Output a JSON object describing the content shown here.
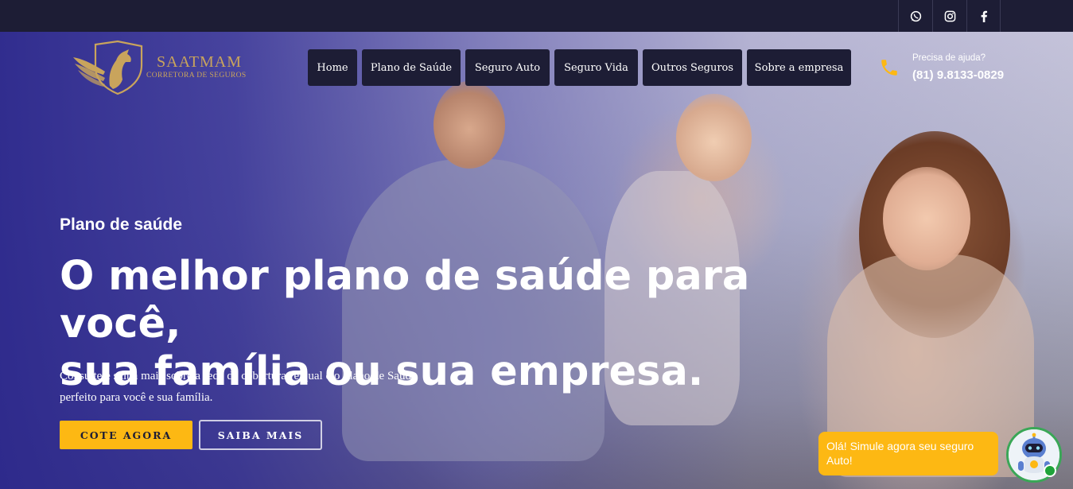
{
  "topbar": {
    "social": [
      {
        "icon": "whatsapp-icon"
      },
      {
        "icon": "instagram-icon"
      },
      {
        "icon": "facebook-icon"
      }
    ]
  },
  "logo": {
    "name": "SAATMAM",
    "subtitle": "CORRETORA DE SEGUROS"
  },
  "nav": {
    "items": [
      {
        "label": "Home"
      },
      {
        "label": "Plano de Saúde"
      },
      {
        "label": "Seguro Auto"
      },
      {
        "label": "Seguro Vida"
      },
      {
        "label": "Outros Seguros"
      },
      {
        "label": "Sobre a empresa"
      }
    ]
  },
  "help": {
    "label": "Precisa de  ajuda?",
    "phone": "(81) 9.8133-0829"
  },
  "hero": {
    "eyebrow": "Plano de saúde",
    "headline_line1": "O melhor plano de saúde para você,",
    "headline_line2": "sua família ou sua empresa.",
    "description_line1": "Consulte e saiba mais sobre a rede de coberturas e qual é o Plano de Saúde",
    "description_line2": "perfeito para você e sua família.",
    "primary_button": "COTE AGORA",
    "secondary_button": "SAIBA MAIS"
  },
  "chat": {
    "message_line1": "Olá! Simule agora seu seguro",
    "message_line2": "Auto!"
  },
  "colors": {
    "topbar": "#1d1d35",
    "accent": "#fdb813",
    "gold": "#c9a45c",
    "online": "#1fa33a"
  }
}
